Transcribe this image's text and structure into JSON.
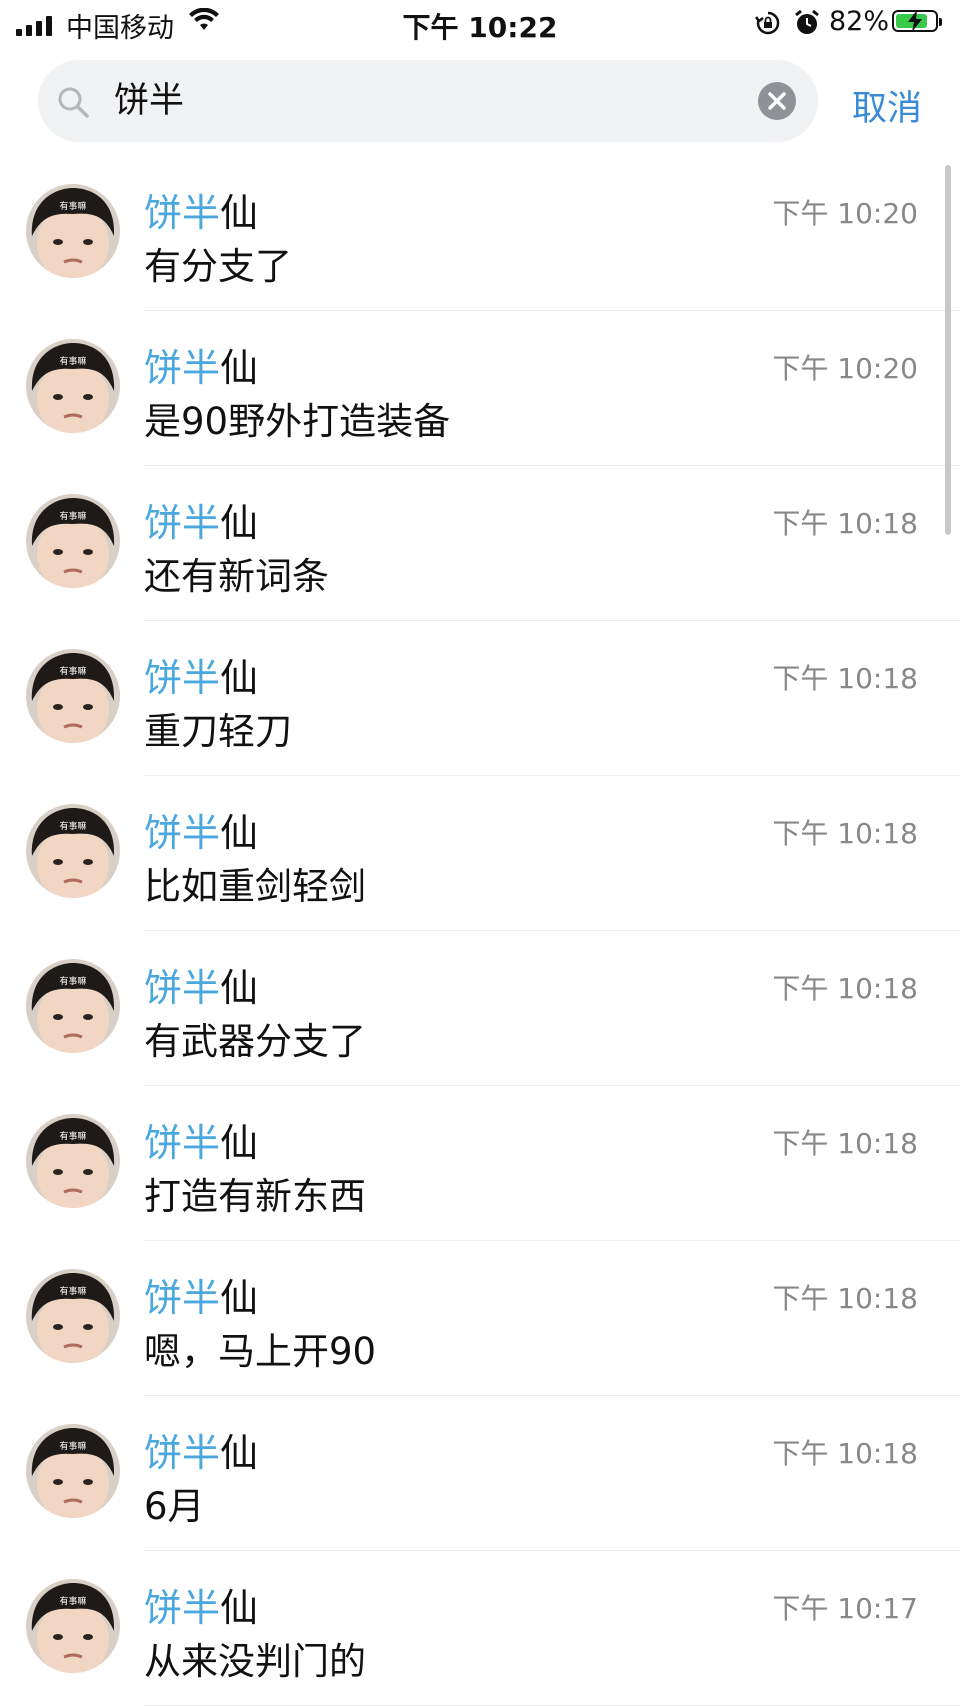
{
  "status_bar": {
    "carrier": "中国移动",
    "time": "下午 10:22",
    "battery_percent": "82%",
    "battery_level": 0.82,
    "icons": [
      "signal-icon",
      "wifi-icon",
      "rotation-lock-icon",
      "alarm-icon",
      "battery-charging-icon"
    ]
  },
  "search": {
    "query": "饼半",
    "cancel_label": "取消"
  },
  "colors": {
    "highlight": "#4aa8de",
    "cancel": "#3a8ad6",
    "time": "#888888"
  },
  "results": [
    {
      "name_match": "饼半",
      "name_rest": "仙",
      "message": "有分支了",
      "time": "下午 10:20"
    },
    {
      "name_match": "饼半",
      "name_rest": "仙",
      "message": "是90野外打造装备",
      "time": "下午 10:20"
    },
    {
      "name_match": "饼半",
      "name_rest": "仙",
      "message": "还有新词条",
      "time": "下午 10:18"
    },
    {
      "name_match": "饼半",
      "name_rest": "仙",
      "message": "重刀轻刀",
      "time": "下午 10:18"
    },
    {
      "name_match": "饼半",
      "name_rest": "仙",
      "message": "比如重剑轻剑",
      "time": "下午 10:18"
    },
    {
      "name_match": "饼半",
      "name_rest": "仙",
      "message": "有武器分支了",
      "time": "下午 10:18"
    },
    {
      "name_match": "饼半",
      "name_rest": "仙",
      "message": "打造有新东西",
      "time": "下午 10:18"
    },
    {
      "name_match": "饼半",
      "name_rest": "仙",
      "message": "嗯，马上开90",
      "time": "下午 10:18"
    },
    {
      "name_match": "饼半",
      "name_rest": "仙",
      "message": "6月",
      "time": "下午 10:18"
    },
    {
      "name_match": "饼半",
      "name_rest": "仙",
      "message": "从来没判门的",
      "time": "下午 10:17"
    }
  ],
  "avatar": {
    "caption": "有事嘛"
  }
}
